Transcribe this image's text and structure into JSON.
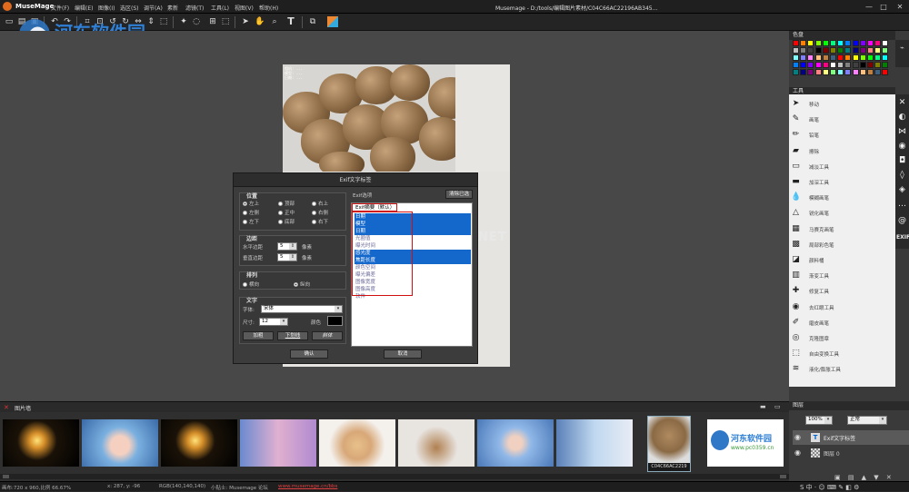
{
  "app": {
    "name": "MuseMage",
    "window_title": "Musemage - D:/tools/编辑图片素材/C04C66AC22196AB345..."
  },
  "menu": [
    "文件(F)",
    "编辑(E)",
    "图像(I)",
    "选区(S)",
    "调节(A)",
    "素新",
    "滤镜(T)",
    "工具(L)",
    "视图(V)",
    "帮助(H)"
  ],
  "window_controls": {
    "minimize": "—",
    "restore": "□",
    "close": "✕"
  },
  "site_watermark": {
    "title": "河东软件园",
    "url": "www.pc0359.cn"
  },
  "canvas_watermark": ".NET",
  "photo_exif_lines": [
    "相机: ...",
    "模型: ...",
    "日期: ..."
  ],
  "dialog": {
    "title": "Exif文字标签",
    "position": {
      "label": "位置",
      "options": [
        "左上",
        "顶部",
        "右上",
        "左侧",
        "正中",
        "右侧",
        "左下",
        "底部",
        "右下"
      ],
      "selected": "左上"
    },
    "margin": {
      "label": "边距",
      "h_label": "水平边距",
      "h_value": "5",
      "v_label": "垂直边距",
      "v_value": "5",
      "unit": "像素"
    },
    "arrange": {
      "label": "排列",
      "options": [
        "横向",
        "纵向"
      ],
      "selected": "纵向"
    },
    "text": {
      "label": "文字",
      "font_label": "字体:",
      "font_value": "宋体",
      "size_label": "尺寸:",
      "size_value": "12",
      "color_label": "颜色",
      "bold": "加粗",
      "underline": "下划线",
      "italic": "斜体"
    },
    "exif_options_label": "Exif选项",
    "clear_button": "清除已选",
    "exif_template": "Exif摘要（默认）",
    "exif_items": [
      {
        "label": "日期",
        "selected": true
      },
      {
        "label": "模型",
        "selected": true
      },
      {
        "label": "日期",
        "selected": true
      },
      {
        "label": "光圈值",
        "selected": false
      },
      {
        "label": "曝光时间",
        "selected": false
      },
      {
        "label": "感光度",
        "selected": true
      },
      {
        "label": "焦距长度",
        "selected": true
      },
      {
        "label": "颜色空间",
        "selected": false
      },
      {
        "label": "曝光偏差",
        "selected": false
      },
      {
        "label": "图像宽度",
        "selected": false
      },
      {
        "label": "图像高度",
        "selected": false
      },
      {
        "label": "软件",
        "selected": false
      }
    ],
    "ok_button": "确认",
    "cancel_button": "取消"
  },
  "right_panel": {
    "colors_header": "色盘",
    "tools_header": "工具",
    "tools": [
      {
        "label": "移动",
        "icon": "arrow-icon"
      },
      {
        "label": "画笔",
        "icon": "brush-icon"
      },
      {
        "label": "铅笔",
        "icon": "pencil-icon"
      },
      {
        "label": "擦除",
        "icon": "eraser-icon"
      },
      {
        "label": "减淡工具",
        "icon": "dodge-icon"
      },
      {
        "label": "加深工具",
        "icon": "burn-icon"
      },
      {
        "label": "模糊画笔",
        "icon": "blur-icon"
      },
      {
        "label": "锐化画笔",
        "icon": "sharpen-icon"
      },
      {
        "label": "马赛克画笔",
        "icon": "mosaic-icon"
      },
      {
        "label": "局部彩色笔",
        "icon": "color-brush-icon"
      },
      {
        "label": "颜料桶",
        "icon": "bucket-icon"
      },
      {
        "label": "渐变工具",
        "icon": "gradient-icon"
      },
      {
        "label": "修复工具",
        "icon": "bandage-icon"
      },
      {
        "label": "去红眼工具",
        "icon": "eye-icon"
      },
      {
        "label": "磨皮画笔",
        "icon": "skin-brush-icon"
      },
      {
        "label": "克隆图章",
        "icon": "stamp-icon"
      },
      {
        "label": "自由变换工具",
        "icon": "transform-icon"
      },
      {
        "label": "液化/膨胀工具",
        "icon": "liquify-icon"
      }
    ],
    "side_exif": "EXIF"
  },
  "filmstrip": {
    "title": "图片墙",
    "selected_caption": "C04C66AC2219"
  },
  "layers": {
    "title": "图层",
    "zoom": "100%",
    "blend": "正常",
    "layer_text": "Exif文字标签",
    "layer_base": "图层 0"
  },
  "status": {
    "info": "画布:720 x 960,比例 66.67%",
    "coords": "x: 287, y: -96",
    "rgb": "RGB(140,140,140)",
    "tip": "小贴士: Musemage 论坛",
    "url": "www.musemage.cn/bbs"
  },
  "colors": {
    "accent": "#1468cc",
    "highlight_red": "#d01010"
  }
}
